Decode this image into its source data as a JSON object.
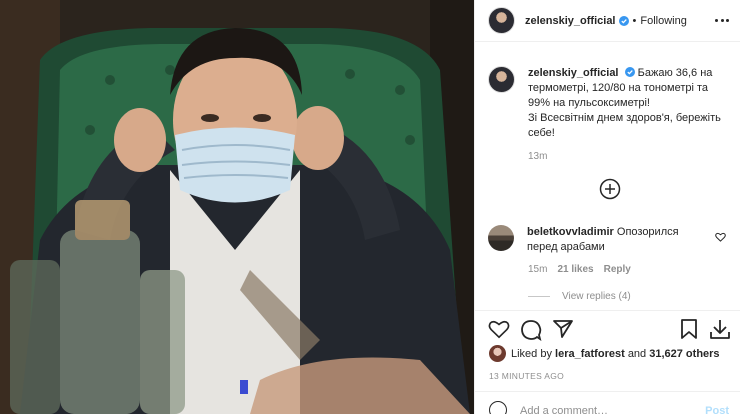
{
  "post": {
    "username": "zelenskiy_official",
    "follow_dot": "•",
    "follow_label": "Following",
    "caption_line": "Бажаю 36,6 на термометрі, 120/80 на тонометрі та 99% на пульсоксиметрі!",
    "caption_line2": "Зі Всесвітнім днем здоров'я, бережіть себе!",
    "caption_time": "13m",
    "liked_by_prefix": "Liked by",
    "liked_by_user": "lera_fatforest",
    "liked_by_and": "and",
    "liked_by_count": "31,627 others",
    "post_age": "13 MINUTES AGO",
    "add_comment_placeholder": "Add a comment…",
    "post_button": "Post"
  },
  "comment": {
    "username": "beletkovvladimir",
    "text": "Опозорился перед арабами",
    "time": "15m",
    "likes": "21 likes",
    "reply": "Reply",
    "view_replies": "View replies (4)"
  },
  "icons": {
    "verified": "verified-badge-icon",
    "more": "more-options-icon",
    "add": "plus-circle-icon",
    "heart": "heart-icon",
    "comment": "comment-icon",
    "share": "share-icon",
    "save": "bookmark-icon",
    "download": "download-icon",
    "emoji": "emoji-icon"
  },
  "colors": {
    "verified": "#3897f0",
    "text": "#262626",
    "muted": "#8e8e8e",
    "post_disabled": "#b2dffc"
  }
}
